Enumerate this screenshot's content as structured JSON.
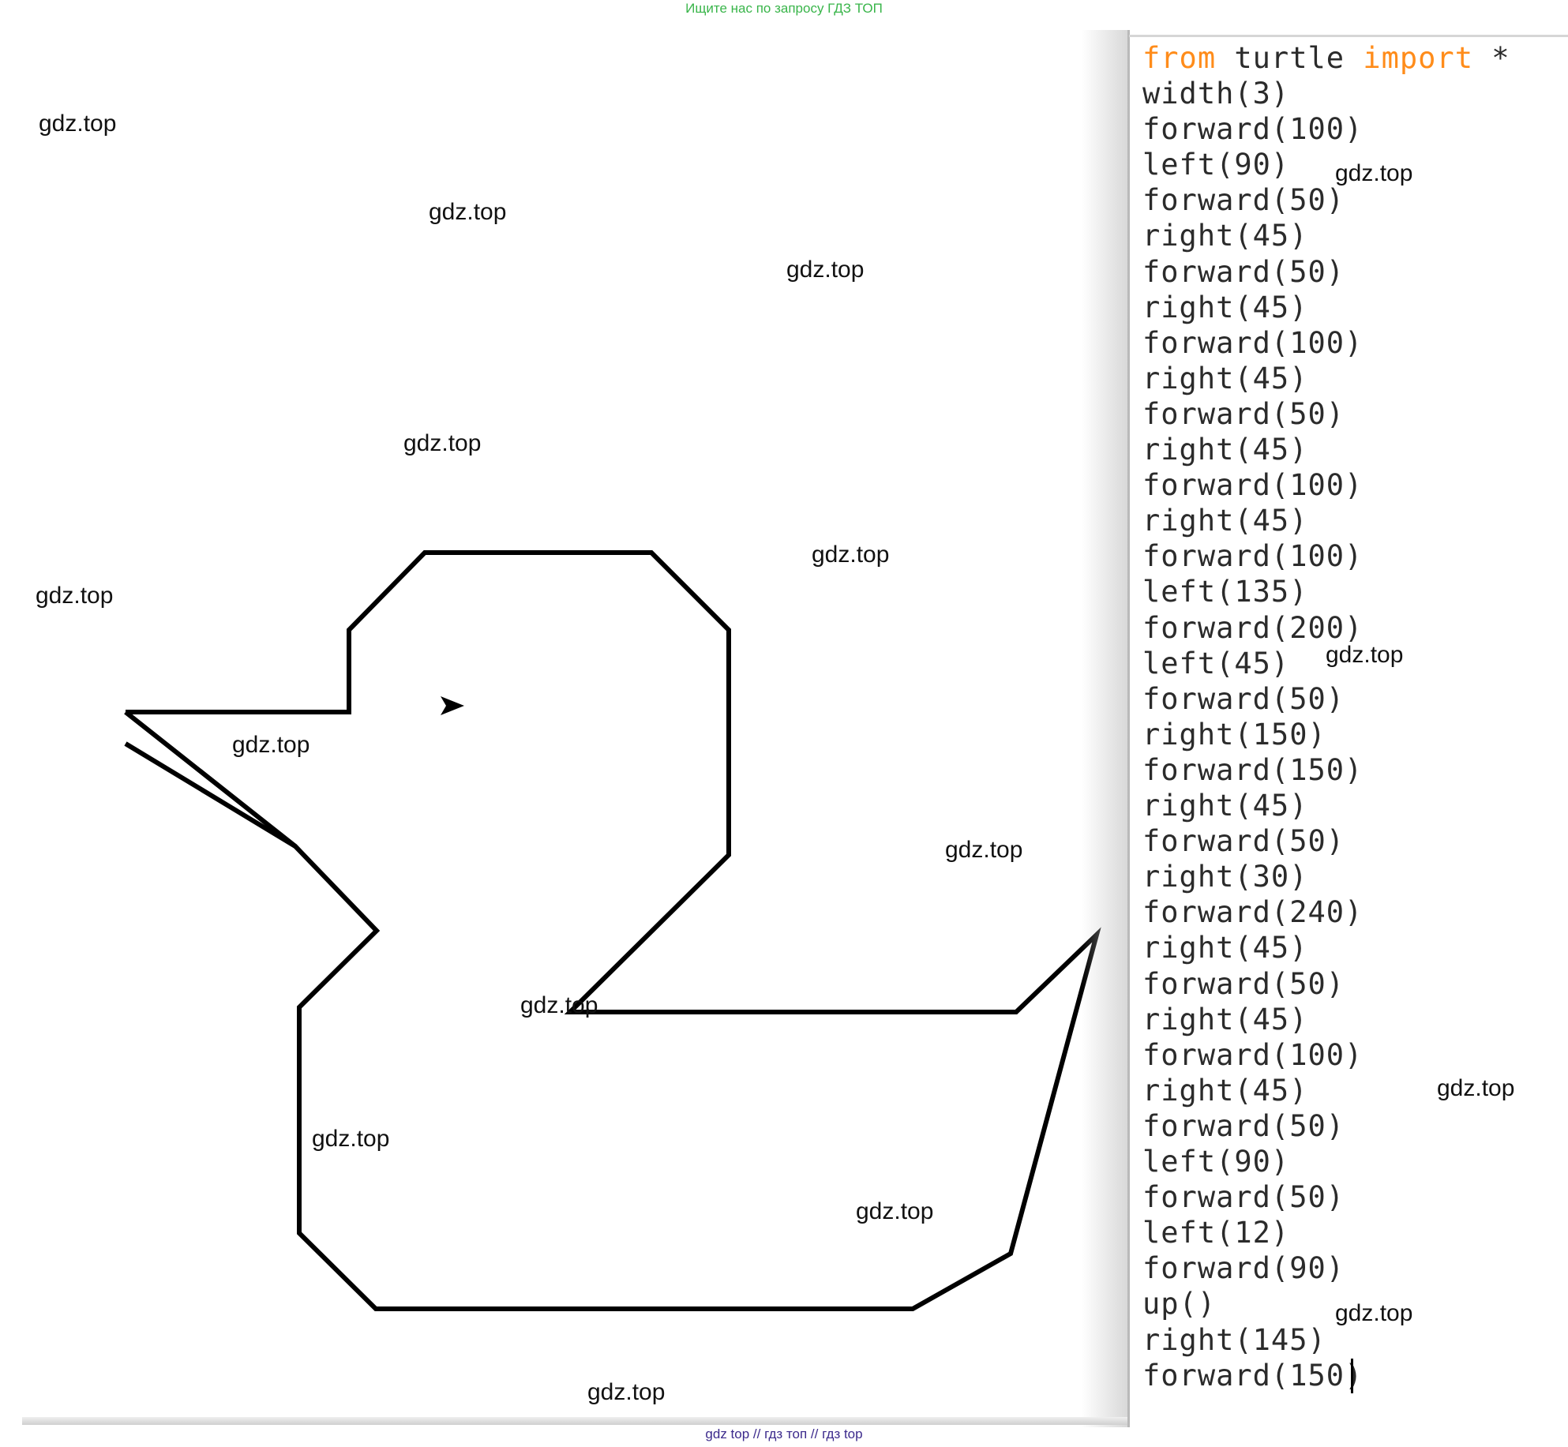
{
  "banner": {
    "text": "Ищите нас по запросу ГДЗ ТОП"
  },
  "editor": {
    "first_line": {
      "kw1": "from",
      "mid": " turtle ",
      "kw2": "import",
      "rest": " *"
    },
    "lines": [
      "width(3)",
      "forward(100)",
      "left(90)",
      "forward(50)",
      "right(45)",
      "forward(50)",
      "right(45)",
      "forward(100)",
      "right(45)",
      "forward(50)",
      "right(45)",
      "forward(100)",
      "right(45)",
      "forward(100)",
      "left(135)",
      "forward(200)",
      "left(45)",
      "forward(50)",
      "right(150)",
      "forward(150)",
      "right(45)",
      "forward(50)",
      "right(30)",
      "forward(240)",
      "right(45)",
      "forward(50)",
      "right(45)",
      "forward(100)",
      "right(45)",
      "forward(50)",
      "left(90)",
      "forward(50)",
      "left(12)",
      "forward(90)",
      "up()",
      "right(145)",
      "forward(150)"
    ],
    "colors": {
      "keyword": "#ff8c1a",
      "text": "#2b2b2b"
    }
  },
  "watermarks": [
    "gdz.top",
    "gdz.top",
    "gdz.top",
    "gdz.top",
    "gdz.top",
    "gdz.top",
    "gdz.top",
    "gdz.top",
    "gdz.top",
    "gdz.top",
    "gdz.top",
    "gdz.top",
    "gdz.top",
    "gdz.top",
    "gdz.top",
    "gdz.top"
  ],
  "footer": {
    "text": "gdz top  //  гдз топ  //  гдз top"
  }
}
